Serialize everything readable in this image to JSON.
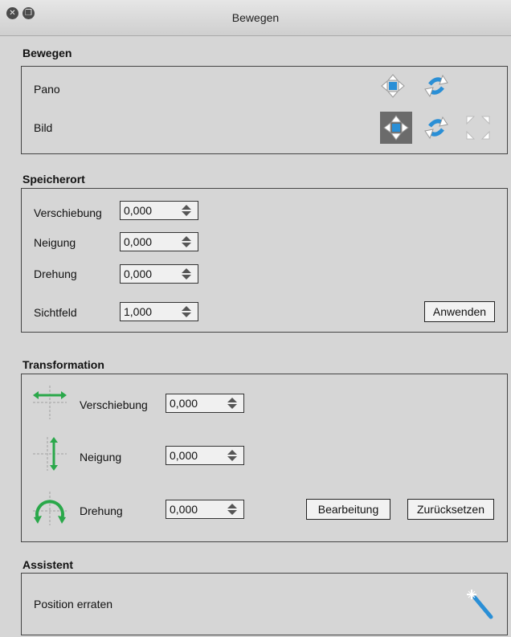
{
  "window": {
    "title": "Bewegen"
  },
  "bewegen": {
    "title": "Bewegen",
    "rows": [
      {
        "label": "Pano"
      },
      {
        "label": "Bild"
      }
    ]
  },
  "speicherort": {
    "title": "Speicherort",
    "fields": [
      {
        "label": "Verschiebung",
        "value": "0,000"
      },
      {
        "label": "Neigung",
        "value": "0,000"
      },
      {
        "label": "Drehung",
        "value": "0,000"
      },
      {
        "label": "Sichtfeld",
        "value": "1,000"
      }
    ],
    "apply_label": "Anwenden"
  },
  "transformation": {
    "title": "Transformation",
    "fields": [
      {
        "label": "Verschiebung",
        "value": "0,000",
        "icon": "translate-horizontal-icon"
      },
      {
        "label": "Neigung",
        "value": "0,000",
        "icon": "tilt-vertical-icon"
      },
      {
        "label": "Drehung",
        "value": "0,000",
        "icon": "rotate-icon"
      }
    ],
    "edit_label": "Bearbeitung",
    "reset_label": "Zurücksetzen"
  },
  "assistent": {
    "title": "Assistent",
    "guess_label": "Position erraten",
    "icon": "magic-wand-icon"
  },
  "colors": {
    "accent_blue": "#2a8fd6",
    "green": "#2aa84a",
    "selected_bg": "#6b6b6b"
  }
}
